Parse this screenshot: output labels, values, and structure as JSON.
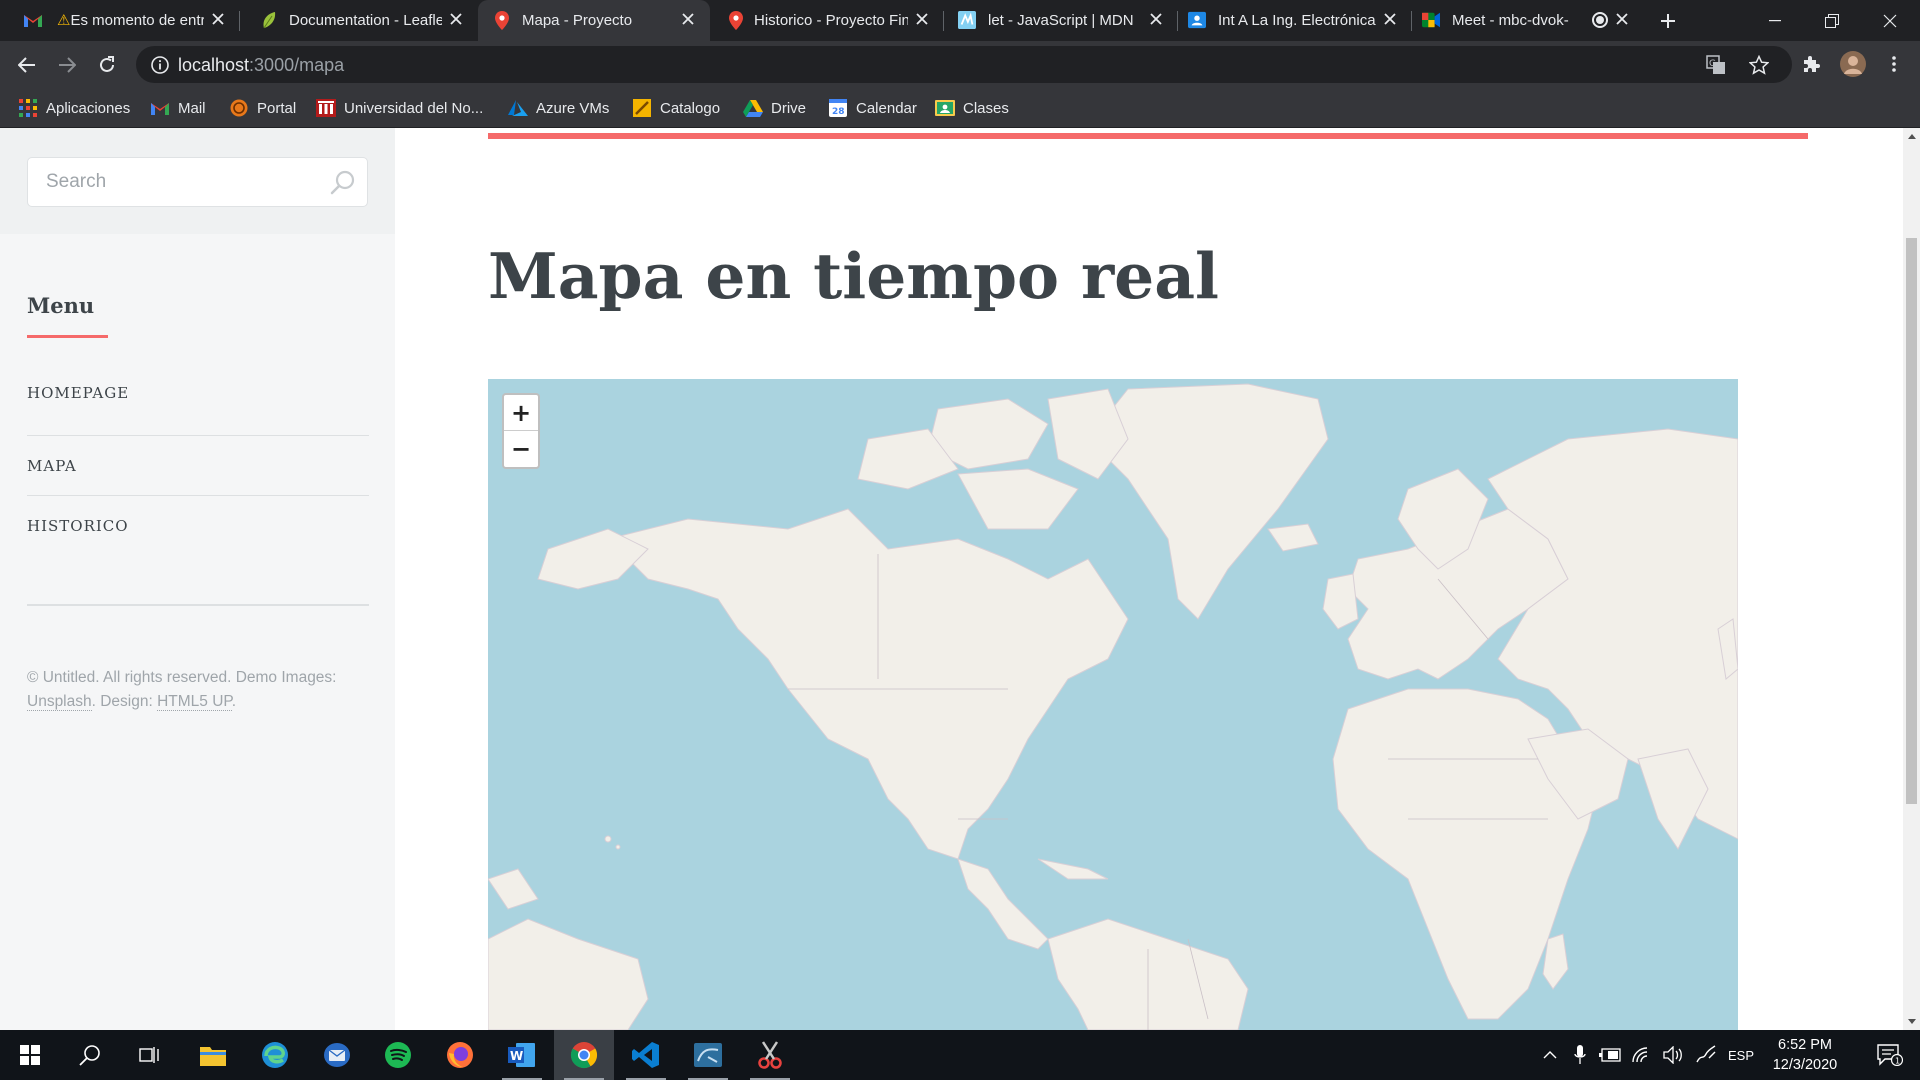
{
  "browser": {
    "tabs": [
      {
        "title": "Es momento de entr",
        "icon": "gmail-icon",
        "warning": "⚠",
        "active": false
      },
      {
        "title": "Documentation - Leaflet",
        "icon": "leaflet-icon",
        "active": false
      },
      {
        "title": "Mapa - Proyecto",
        "icon": "map-pin-icon",
        "active": true
      },
      {
        "title": "Historico - Proyecto Final",
        "icon": "map-pin-icon",
        "active": false
      },
      {
        "title": "let - JavaScript | MDN",
        "icon": "mdn-icon",
        "active": false
      },
      {
        "title": "Int A La Ing. Electrónica",
        "icon": "classroom-icon",
        "active": false
      },
      {
        "title": "Meet - mbc-dvok-",
        "icon": "meet-icon",
        "active": false
      }
    ],
    "close_symbol": "✕",
    "new_tab_symbol": "+",
    "window_controls": {
      "minimize": "—",
      "restore": "❐",
      "close": "✕"
    },
    "url": {
      "host": "localhost",
      "path": ":3000/mapa"
    },
    "bookmarks": [
      {
        "label": "Aplicaciones",
        "icon": "apps-grid-icon"
      },
      {
        "label": "Mail",
        "icon": "gmail-icon"
      },
      {
        "label": "Portal",
        "icon": "portal-icon"
      },
      {
        "label": "Universidad del No...",
        "icon": "university-icon"
      },
      {
        "label": "Azure VMs",
        "icon": "azure-icon"
      },
      {
        "label": "Catalogo",
        "icon": "catalog-icon"
      },
      {
        "label": "Drive",
        "icon": "drive-icon"
      },
      {
        "label": "Calendar",
        "icon": "calendar-icon"
      },
      {
        "label": "Clases",
        "icon": "classroom-icon"
      }
    ]
  },
  "page": {
    "search_placeholder": "Search",
    "menu_title": "Menu",
    "menu_items": [
      "HOMEPAGE",
      "MAPA",
      "HISTORICO"
    ],
    "footer": {
      "text1": "© Untitled. All rights reserved. Demo Images: ",
      "link1": "Unsplash",
      "text2": ". Design: ",
      "link2": "HTML5 UP",
      "text3": "."
    },
    "heading": "Mapa en tiempo real",
    "zoom_in": "+",
    "zoom_out": "−",
    "accent_color": "#f56a6a",
    "map_water_color": "#aad3df",
    "map_land_color": "#f2efe9"
  },
  "taskbar": {
    "apps": [
      "windows-start-icon",
      "search-icon",
      "task-view-icon",
      "file-explorer-icon",
      "edge-icon",
      "thunderbird-icon",
      "spotify-icon",
      "firefox-icon",
      "word-icon",
      "chrome-icon",
      "vscode-icon",
      "mysql-workbench-icon",
      "snipping-tool-icon"
    ],
    "language": "ESP",
    "time": "6:52 PM",
    "date": "12/3/2020",
    "notification_count": "1"
  }
}
